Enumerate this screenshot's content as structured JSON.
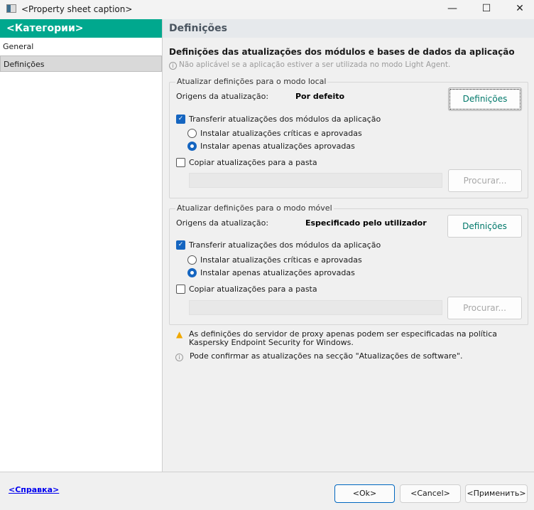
{
  "window": {
    "title": "<Property sheet caption>"
  },
  "sidebar": {
    "header": "<Категории>",
    "items": [
      {
        "label": "General"
      },
      {
        "label": "Definições"
      }
    ]
  },
  "main": {
    "header": "Definições",
    "title": "Definições das atualizações dos módulos e bases de dados da aplicação",
    "note": "Não aplicável se a aplicação estiver a ser utilizada no modo Light Agent.",
    "groups": [
      {
        "legend": "Atualizar definições para o modo local",
        "source_label": "Origens da atualização:",
        "source_value": "Por defeito",
        "settings_button": "Definições",
        "transfer_label": "Transferir atualizações dos módulos da aplicação",
        "transfer_checked": true,
        "radio_critical": "Instalar atualizações críticas e aprovadas",
        "radio_approved": "Instalar apenas atualizações aprovadas",
        "selected_radio": "approved",
        "copy_label": "Copiar atualizações para a pasta",
        "copy_checked": false,
        "path_value": "",
        "browse_button": "Procurar..."
      },
      {
        "legend": "Atualizar definições para o modo móvel",
        "source_label": "Origens da atualização:",
        "source_value": "Especificado pelo utilizador",
        "settings_button": "Definições",
        "transfer_label": "Transferir atualizações dos módulos da aplicação",
        "transfer_checked": true,
        "radio_critical": "Instalar atualizações críticas e aprovadas",
        "radio_approved": "Instalar apenas atualizações aprovadas",
        "selected_radio": "approved",
        "copy_label": "Copiar atualizações para a pasta",
        "copy_checked": false,
        "path_value": "",
        "browse_button": "Procurar..."
      }
    ],
    "warning": "As definições do servidor de proxy apenas podem ser especificadas na política Kaspersky Endpoint Security for Windows.",
    "info": "Pode confirmar as atualizações na secção \"Atualizações de software\"."
  },
  "footer": {
    "help": "<Справка>",
    "ok": "<Ok>",
    "cancel": "<Cancel>",
    "apply": "<Применить>"
  },
  "colors": {
    "accent": "#00a88e",
    "check": "#1565c0"
  }
}
